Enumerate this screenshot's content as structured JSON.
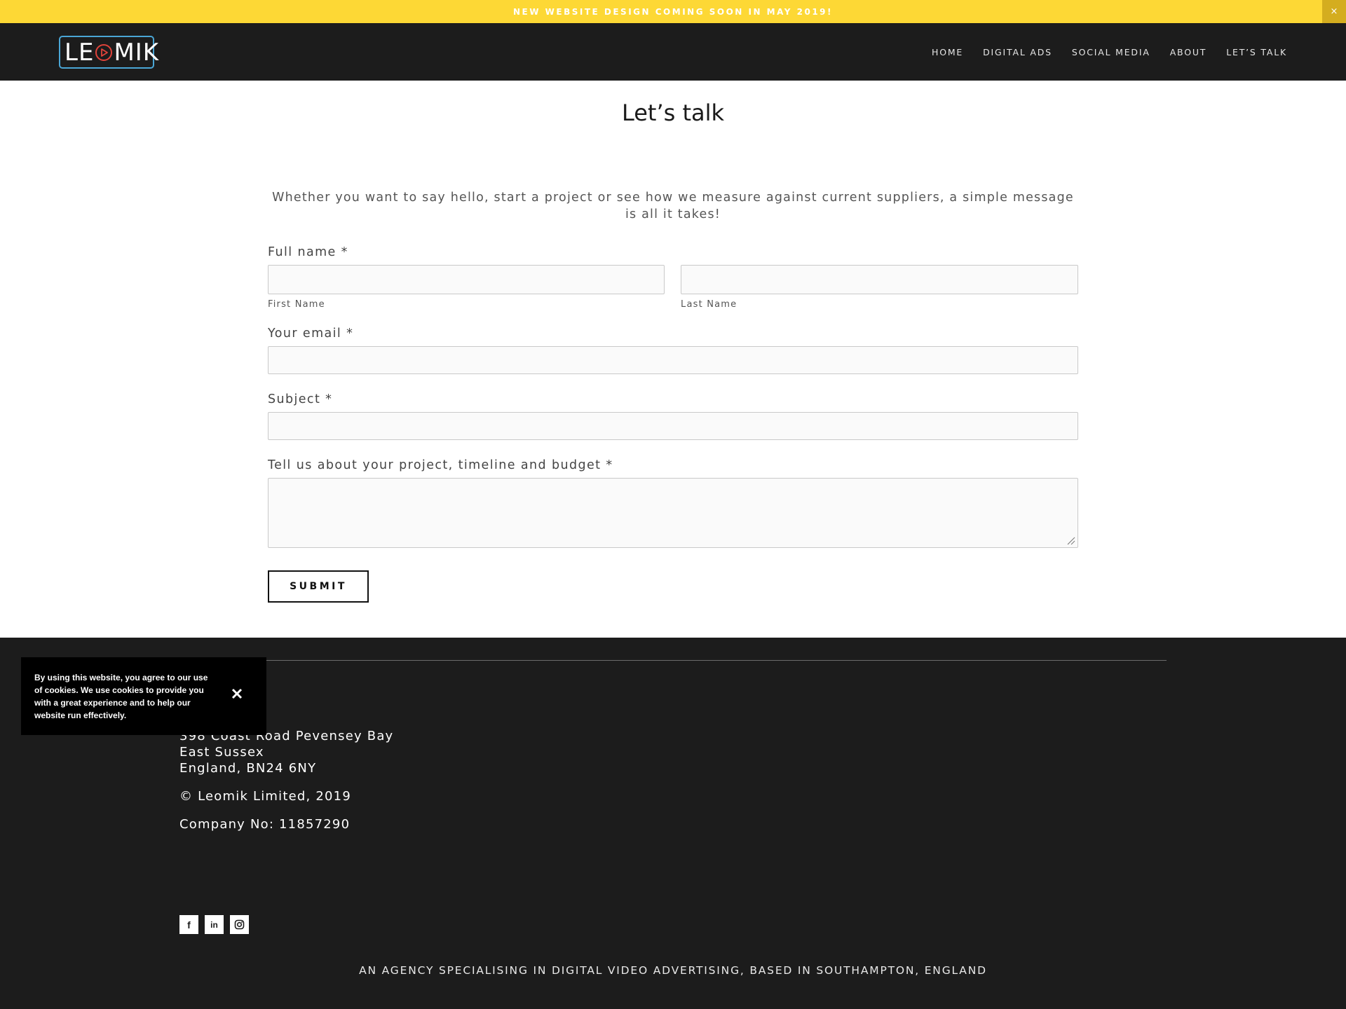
{
  "announcement": {
    "text": "NEW WEBSITE DESIGN COMING SOON IN MAY 2019!",
    "close": "×"
  },
  "header": {
    "logo": {
      "before": "LE",
      "after": "MIK",
      "icon": "play-icon"
    },
    "nav": [
      "HOME",
      "DIGITAL ADS",
      "SOCIAL MEDIA",
      "ABOUT",
      "LET’S TALK"
    ]
  },
  "main": {
    "title": "Let’s talk",
    "intro": "Whether you want to say hello, start a project or see how we measure against current suppliers, a simple message is all it takes!",
    "form": {
      "full_name_label": "Full name *",
      "first_name_sublabel": "First Name",
      "last_name_sublabel": "Last Name",
      "email_label": "Your email *",
      "subject_label": "Subject *",
      "message_label": "Tell us about your project, timeline and budget *",
      "first_name_value": "",
      "last_name_value": "",
      "email_value": "",
      "subject_value": "",
      "message_value": "",
      "submit_label": "SUBMIT"
    }
  },
  "footer": {
    "address": [
      "398 Coast Road Pevensey Bay",
      "East Sussex",
      "England, BN24 6NY"
    ],
    "copyright": "© Leomik Limited, 2019",
    "company_no": "Company No: 11857290",
    "social": [
      {
        "icon": "facebook-icon",
        "glyph": "f"
      },
      {
        "icon": "linkedin-icon",
        "glyph": "in"
      },
      {
        "icon": "instagram-icon",
        "glyph": ""
      }
    ],
    "tagline": "AN AGENCY SPECIALISING IN DIGITAL VIDEO ADVERTISING, BASED IN SOUTHAMPTON, ENGLAND"
  },
  "cookie": {
    "text": "By using this website, you agree to our use of cookies. We use cookies to provide you with a great experience and to help our website run effectively."
  },
  "colors": {
    "accent_yellow": "#fdd835",
    "dark": "#1c1c1c",
    "logo_blue": "#4aa6d6",
    "logo_red": "#e0433a"
  }
}
